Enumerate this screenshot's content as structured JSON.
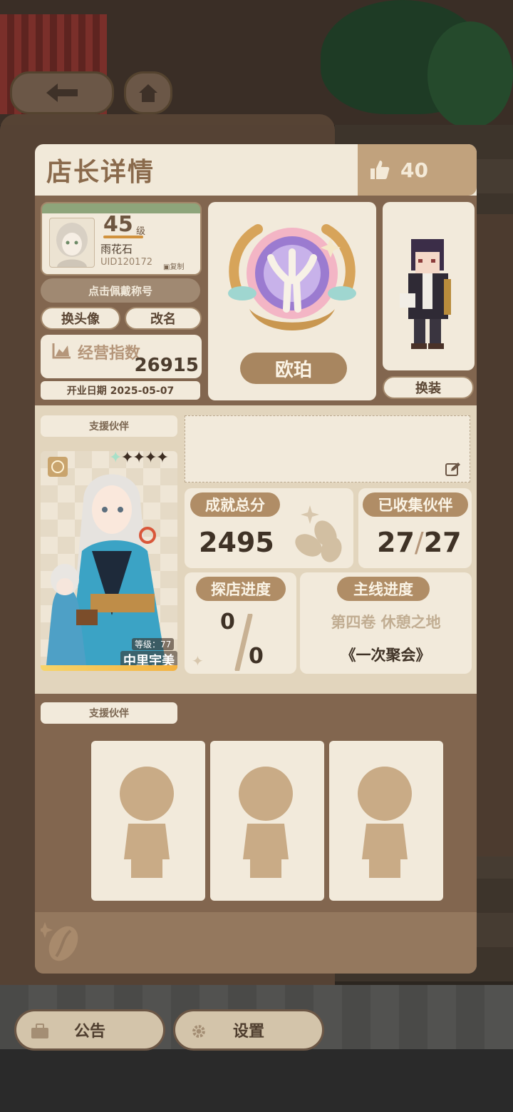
{
  "window": {
    "title": "店长详情"
  },
  "nav": {
    "back_icon": "arrow-left-icon",
    "home_icon": "home-icon"
  },
  "likes": {
    "icon": "thumbs-up-icon",
    "count": "40"
  },
  "profile": {
    "level": "45",
    "level_unit": "级",
    "name": "雨花石",
    "uid": "UID120172",
    "copy_label": "复制",
    "title_button": "点击佩戴称号",
    "change_avatar": "换头像",
    "rename": "改名",
    "business_index_label": "经营指数",
    "business_index_value": "26915",
    "open_date": "开业日期 2025-05-07"
  },
  "badge": {
    "name": "欧珀"
  },
  "outfit": {
    "button": "换装"
  },
  "support": {
    "label": "支援伙伴",
    "partner_level": "等级：77",
    "partner_name": "中里宇美",
    "stars": 4
  },
  "stats": {
    "achievement_label": "成就总分",
    "achievement_value": "2495",
    "collected_label": "已收集伙伴",
    "collected_value": "27",
    "collected_total": "27",
    "explore_label": "探店进度",
    "explore_value": "0",
    "explore_total": "0",
    "main_label": "主线进度",
    "main_chapter": "第四卷 休憩之地",
    "main_episode": "《一次聚会》"
  },
  "support_slots": {
    "label": "支援伙伴",
    "slots": 3
  },
  "bottom": {
    "notice": "公告",
    "settings": "设置"
  },
  "colors": {
    "panel": "#82664f",
    "cream": "#f2eadb",
    "accent": "#b08d66"
  }
}
